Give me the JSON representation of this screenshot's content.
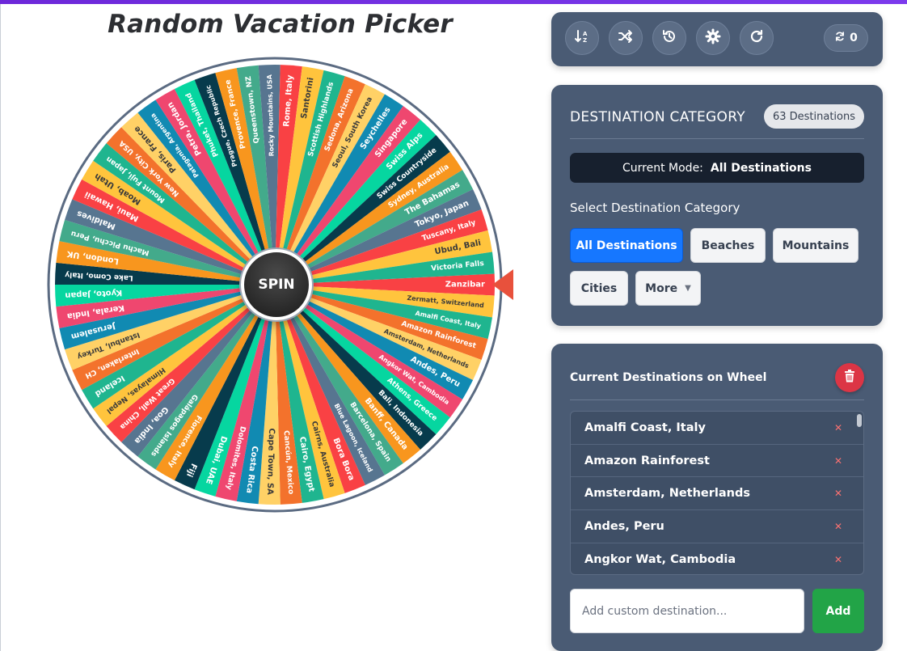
{
  "page": {
    "title": "Random Vacation Picker"
  },
  "colors": {
    "accent_bar": "#7c3aed",
    "panel_bg": "#4a5b74",
    "active_button": "#1677ff",
    "add_button": "#22a447",
    "delete_button": "#dc3545",
    "pointer": "#e8513c"
  },
  "wheel": {
    "spin_label": "SPIN",
    "palette": [
      "#f94144",
      "#ffc43d",
      "#1fb58f",
      "#f3722c",
      "#ffd166",
      "#118ab2",
      "#ef476f",
      "#06d6a0",
      "#073b4c",
      "#f8961e",
      "#43aa8b",
      "#577590"
    ],
    "segments": [
      "Zanzibar",
      "Zermatt, Switzerland",
      "Amalfi Coast, Italy",
      "Amazon Rainforest",
      "Amsterdam, Netherlands",
      "Andes, Peru",
      "Angkor Wat, Cambodia",
      "Athens, Greece",
      "Bali, Indonesia",
      "Banff, Canada",
      "Barcelona, Spain",
      "Blue Lagoon, Iceland",
      "Bora Bora",
      "Cairns, Australia",
      "Cairo, Egypt",
      "Cancún, Mexico",
      "Cape Town, SA",
      "Costa Rica",
      "Dolomites, Italy",
      "Dubai, UAE",
      "Fiji",
      "Florence, Italy",
      "Galápagos Islands",
      "Goa, India",
      "Great Wall, China",
      "Himalayas, Nepal",
      "Iceland",
      "Interlaken, CH",
      "Istanbul, Turkey",
      "Jerusalem",
      "Kerala, India",
      "Kyoto, Japan",
      "Lake Como, Italy",
      "London, UK",
      "Machu Picchu, Peru",
      "Maldives",
      "Maui, Hawaii",
      "Moab, Utah",
      "Mount Fuji, Japan",
      "New York City, USA",
      "Paris, France",
      "Patagonia, Argentina",
      "Petra, Jordan",
      "Phuket, Thailand",
      "Prague, Czech Republic",
      "Provence, France",
      "Queenstown, NZ",
      "Rocky Mountains, USA",
      "Rome, Italy",
      "Santorini",
      "Scottish Highlands",
      "Sedona, Arizona",
      "Seoul, South Korea",
      "Seychelles",
      "Singapore",
      "Swiss Alps",
      "Swiss Countryside",
      "Sydney, Australia",
      "The Bahamas",
      "Tokyo, Japan",
      "Tuscany, Italy",
      "Ubud, Bali",
      "Victoria Falls"
    ]
  },
  "toolbar": {
    "buttons": [
      {
        "name": "sort",
        "icon": "sort-icon"
      },
      {
        "name": "shuffle",
        "icon": "shuffle-icon"
      },
      {
        "name": "history",
        "icon": "history-icon"
      },
      {
        "name": "settings",
        "icon": "gear-icon"
      },
      {
        "name": "reset",
        "icon": "redo-icon"
      }
    ],
    "spin_count": "0"
  },
  "category_panel": {
    "heading": "DESTINATION CATEGORY",
    "count_badge": "63 Destinations",
    "mode_label": "Current Mode:",
    "mode_value": "All Destinations",
    "select_label": "Select Destination Category",
    "buttons": [
      "All Destinations",
      "Beaches",
      "Mountains",
      "Cities",
      "More"
    ],
    "active": "All Destinations"
  },
  "current_panel": {
    "heading": "Current Destinations on Wheel",
    "items": [
      "Amalfi Coast, Italy",
      "Amazon Rainforest",
      "Amsterdam, Netherlands",
      "Andes, Peru",
      "Angkor Wat, Cambodia"
    ],
    "add_placeholder": "Add custom destination...",
    "add_label": "Add"
  }
}
